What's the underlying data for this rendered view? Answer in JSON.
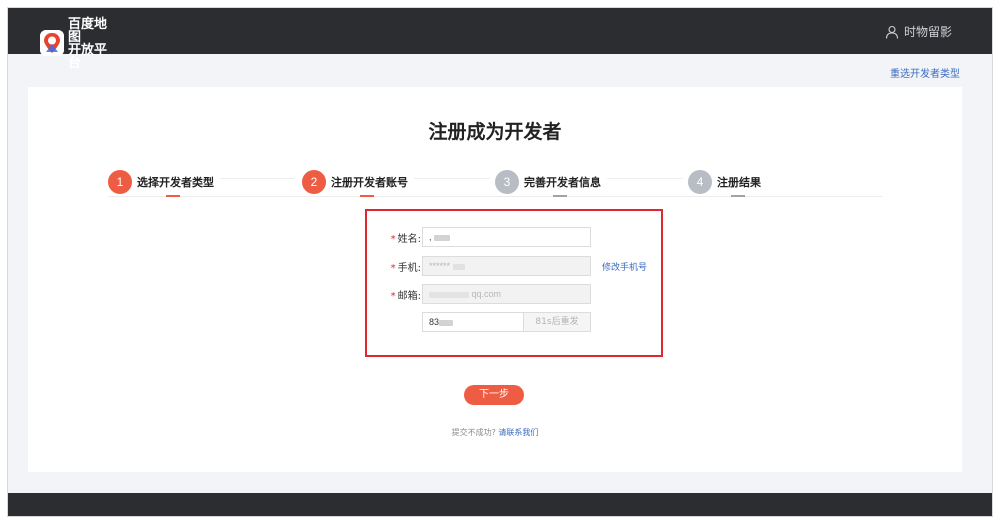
{
  "header": {
    "logo_line1": "百度地图",
    "logo_line2": "开放平台",
    "user_name": "时物留影",
    "user_icon": "user-icon",
    "logo_icon": "baidu-map-logo-icon"
  },
  "reselect_link": "重选开发者类型",
  "page_title": "注册成为开发者",
  "steps": [
    {
      "num": "1",
      "label": "选择开发者类型",
      "state": "active"
    },
    {
      "num": "2",
      "label": "注册开发者账号",
      "state": "active"
    },
    {
      "num": "3",
      "label": "完善开发者信息",
      "state": "inactive"
    },
    {
      "num": "4",
      "label": "注册结果",
      "state": "inactive"
    }
  ],
  "form": {
    "required_mark": "*",
    "name_label": "姓名:",
    "name_value": ",",
    "phone_label": "手机:",
    "phone_value": "******",
    "change_phone_link": "修改手机号",
    "email_label": "邮箱:",
    "email_value": "qq.com",
    "code_value": "83",
    "resend_label": "81s后重发"
  },
  "next_button": "下一步",
  "help": {
    "prefix": "提交不成功?",
    "contact": "请联系我们"
  },
  "colors": {
    "accent": "#ee5c43",
    "highlight_border": "#e0262f",
    "link": "#3a6bbf",
    "header_bg": "#2b2d31"
  }
}
